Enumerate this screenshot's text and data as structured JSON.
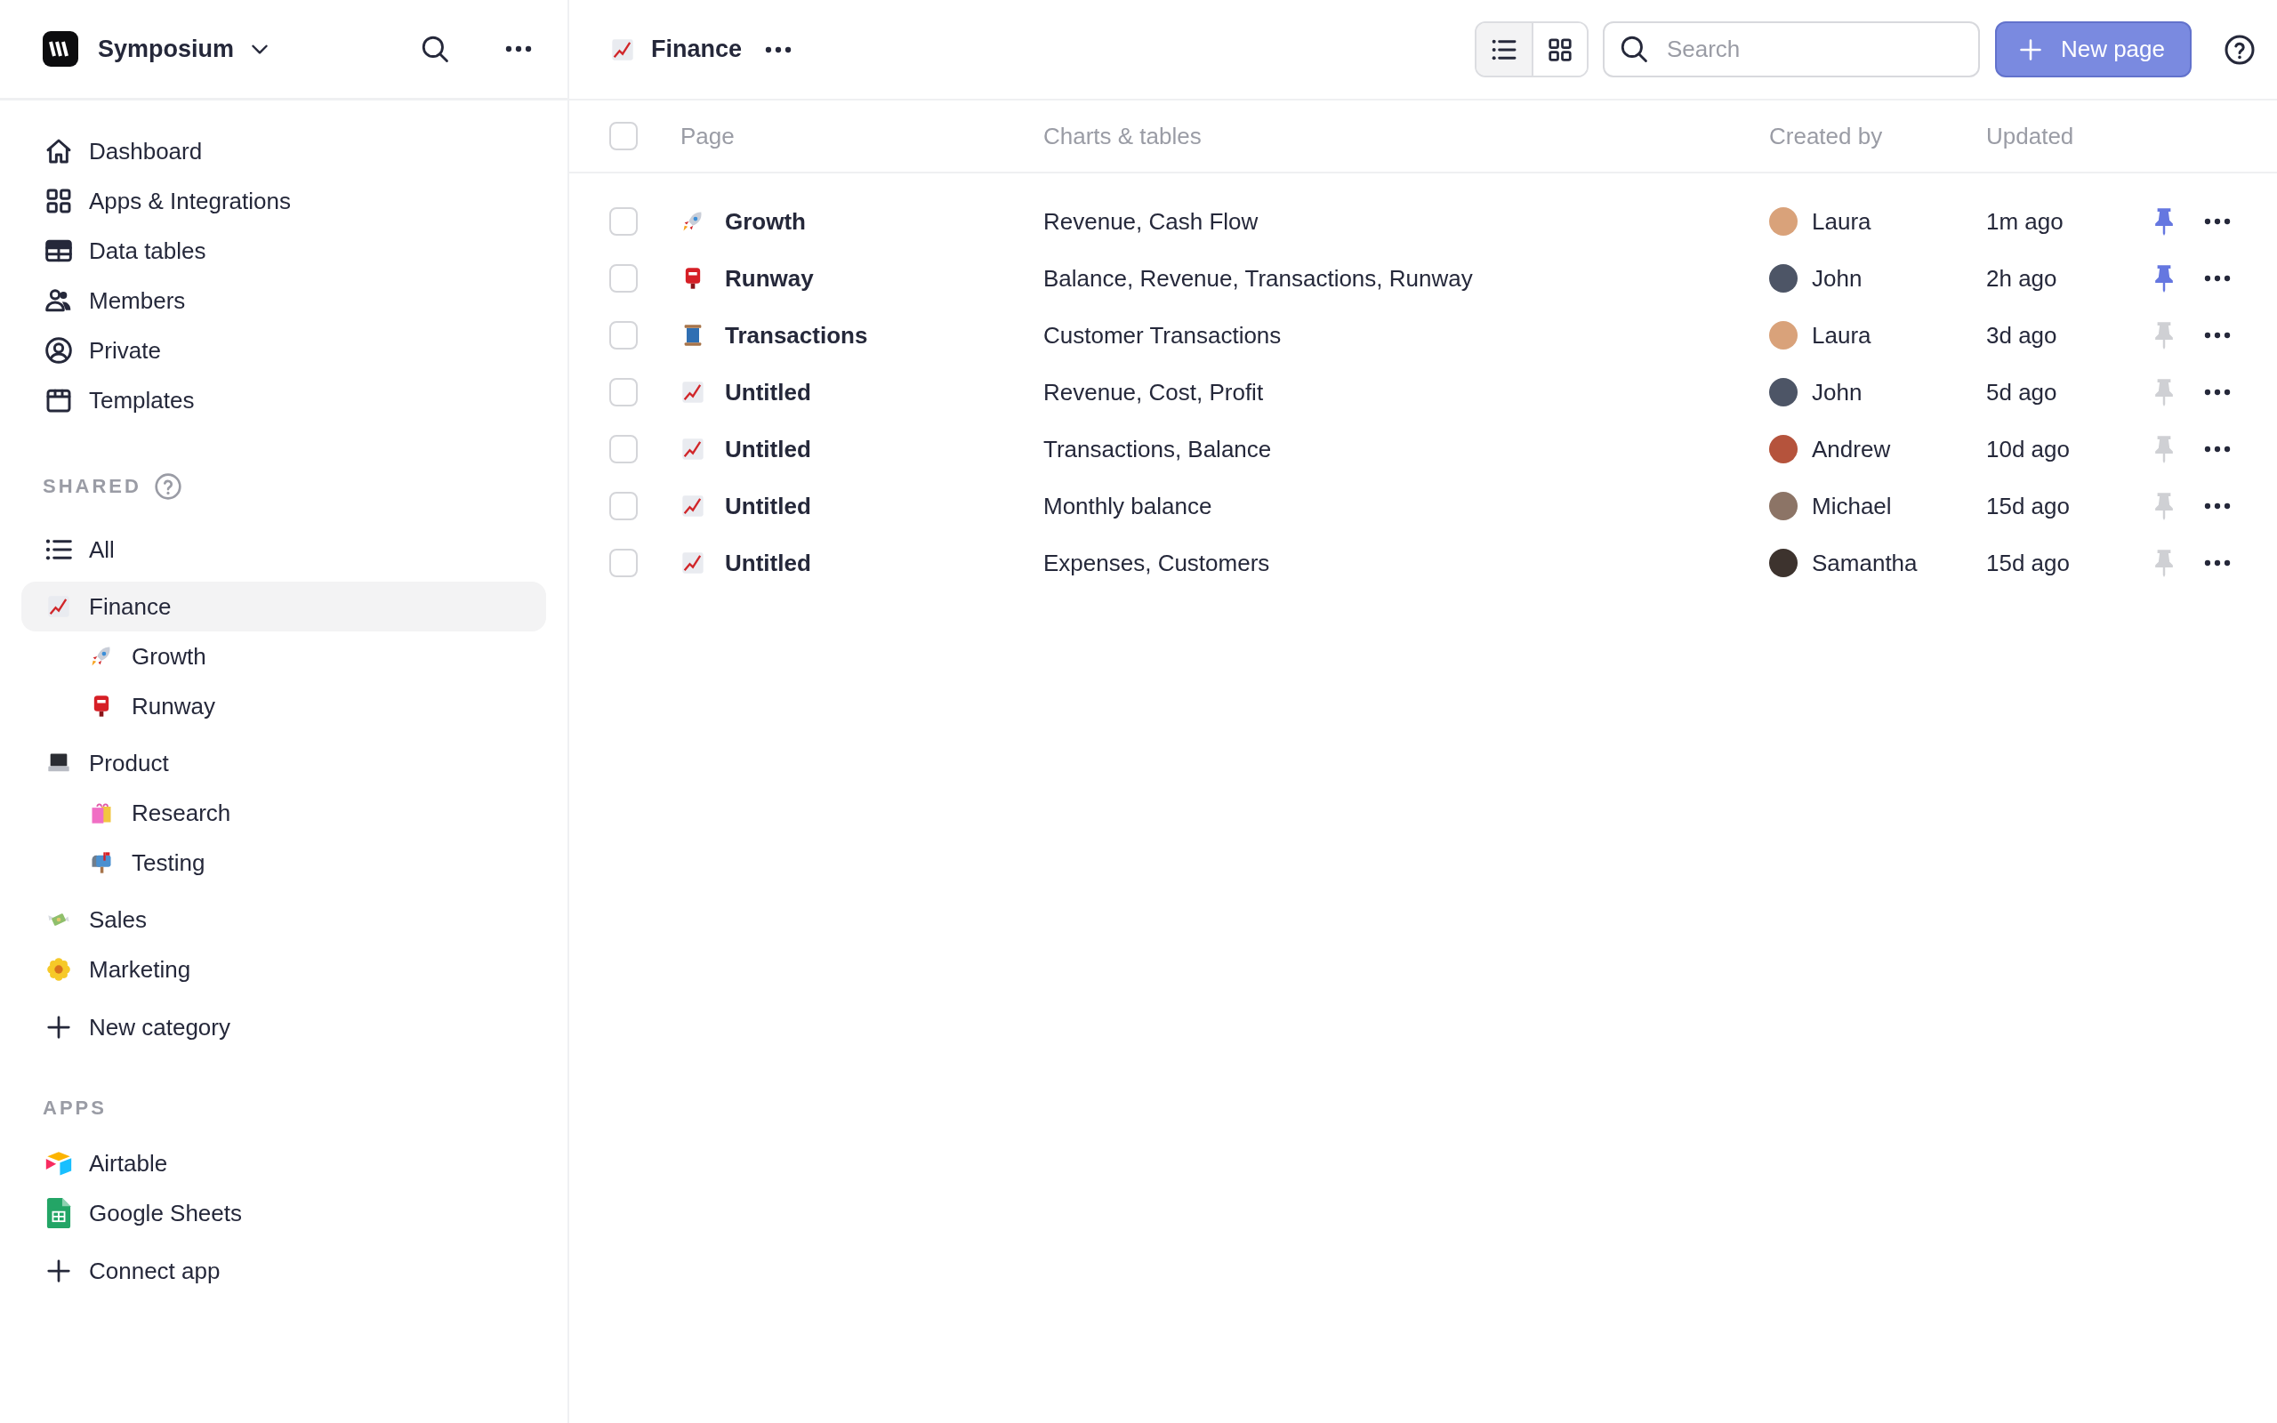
{
  "sidebar": {
    "workspace": {
      "name": "Symposium"
    },
    "nav": [
      {
        "label": "Dashboard",
        "selected": false
      },
      {
        "label": "Apps & Integrations",
        "selected": false
      },
      {
        "label": "Data tables",
        "selected": false
      },
      {
        "label": "Members",
        "selected": false
      },
      {
        "label": "Private",
        "selected": false
      },
      {
        "label": "Templates",
        "selected": false
      }
    ],
    "shared": {
      "heading": "SHARED",
      "items": [
        {
          "label": "All",
          "selected": false
        },
        {
          "label": "Finance",
          "selected": true,
          "children": [
            {
              "label": "Growth",
              "selected": false
            },
            {
              "label": "Runway",
              "selected": false
            }
          ]
        },
        {
          "label": "Product",
          "selected": false,
          "children": [
            {
              "label": "Research",
              "selected": false
            },
            {
              "label": "Testing",
              "selected": false
            }
          ]
        },
        {
          "label": "Sales",
          "selected": false
        },
        {
          "label": "Marketing",
          "selected": false
        }
      ],
      "add_label": "New category"
    },
    "apps": {
      "heading": "APPS",
      "items": [
        {
          "label": "Airtable"
        },
        {
          "label": "Google Sheets"
        }
      ],
      "add_label": "Connect app"
    }
  },
  "header": {
    "title": "Finance",
    "views": [
      {
        "selected": true
      },
      {
        "selected": false
      }
    ],
    "search": {
      "placeholder": "Search"
    },
    "new_button": "New page"
  },
  "table": {
    "columns": [
      "Page",
      "Charts & tables",
      "Created by",
      "Updated"
    ],
    "all_checked": false,
    "rows": [
      {
        "page": "Growth",
        "charts": "Revenue, Cash Flow",
        "created_by": "Laura",
        "updated": "1m ago",
        "pinned": true,
        "checked": false
      },
      {
        "page": "Runway",
        "charts": "Balance, Revenue, Transactions, Runway",
        "created_by": "John",
        "updated": "2h ago",
        "pinned": true,
        "checked": false
      },
      {
        "page": "Transactions",
        "charts": "Customer Transactions",
        "created_by": "Laura",
        "updated": "3d ago",
        "pinned": false,
        "checked": false
      },
      {
        "page": "Untitled",
        "charts": "Revenue, Cost, Profit",
        "created_by": "John",
        "updated": "5d ago",
        "pinned": false,
        "checked": false
      },
      {
        "page": "Untitled",
        "charts": "Transactions, Balance",
        "created_by": "Andrew",
        "updated": "10d ago",
        "pinned": false,
        "checked": false
      },
      {
        "page": "Untitled",
        "charts": "Monthly balance",
        "created_by": "Michael",
        "updated": "15d ago",
        "pinned": false,
        "checked": false
      },
      {
        "page": "Untitled",
        "charts": "Expenses, Customers",
        "created_by": "Samantha",
        "updated": "15d ago",
        "pinned": false,
        "checked": false
      }
    ]
  }
}
